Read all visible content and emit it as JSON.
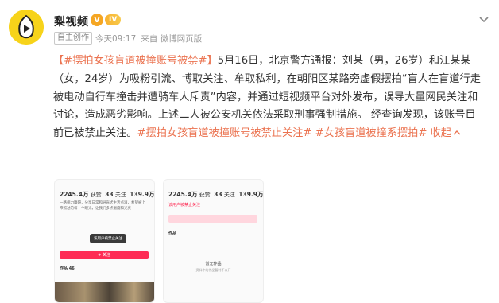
{
  "header": {
    "account_name": "梨视频",
    "badge_v": "V",
    "badge_level": "IV",
    "tag": "自主创作",
    "time": "今天09:17",
    "source": "来自 微博网页版"
  },
  "post": {
    "hashtag_open": "【#摆拍女孩盲道被撞账号被禁#】",
    "body": "5月16日，北京警方通报：刘某（男，26岁）和江某某（女，24岁）为吸粉引流、博取关注、牟取私利，在朝阳区某路旁虚假摆拍“盲人在盲道行走被电动自行车撞击并遭骑车人斥责”内容，并通过短视频平台对外发布，误导大量网民关注和讨论，造成恶劣影响。上述二人被公安机关依法采取刑事强制措施。 经查询发现，该账号目前已被禁止关注。",
    "hashtag_2": "#摆拍女孩盲道被撞账号被禁止关注#",
    "hashtag_3": "#女孩盲道被撞系摆拍#",
    "collapse_label": "收起"
  },
  "thumbnails": [
    {
      "stat_1": "2245.4万",
      "stat_1_label": "获赞",
      "stat_2": "33",
      "stat_2_label": "关注",
      "stat_3": "139.9万",
      "stat_3_label": "粉丝",
      "bio": "一路视力障碍，分享日常和导盲犬生活点滴，希望被上帝照过的每一个眼光，让我们多点温度和光亮",
      "tooltip": "该用户被禁止关注",
      "button": "+ 关注",
      "tab": "作品 46"
    },
    {
      "stat_1": "2245.4万",
      "stat_1_label": "获赞",
      "stat_2": "33",
      "stat_2_label": "关注",
      "stat_3": "139.9万",
      "stat_3_label": "粉丝",
      "notice": "该用户被禁止关注",
      "tab": "作品",
      "empty_title": "暂无作品",
      "empty_sub": "资料中的作品暂时不公开"
    }
  ]
}
